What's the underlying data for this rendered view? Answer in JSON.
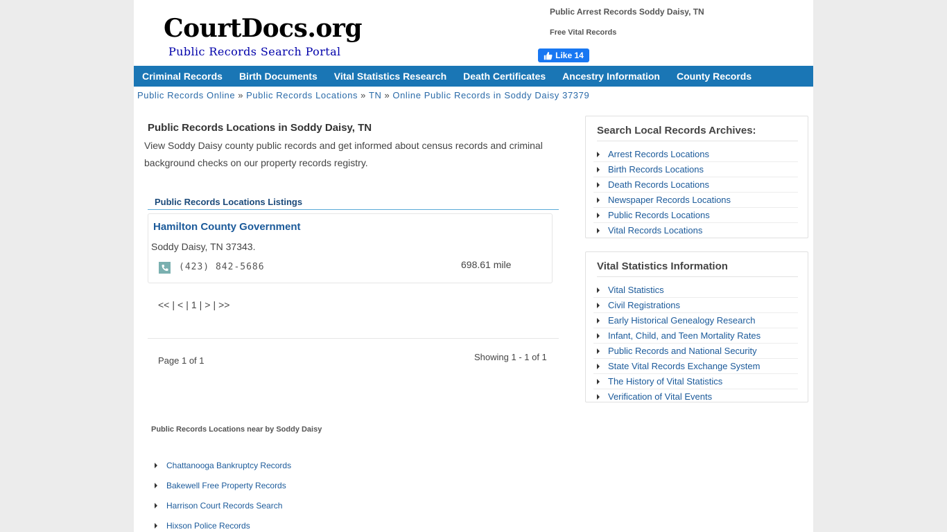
{
  "header": {
    "logo_title": "CourtDocs.org",
    "logo_subtitle": "Public Records Search Portal",
    "top_link_1": "Public Arrest Records Soddy Daisy, TN",
    "top_link_2": "Free Vital Records",
    "fb_like_label": "Like 14",
    "fb_color": "#1877f2"
  },
  "nav": {
    "color": "#1a76b5",
    "items": [
      "Criminal Records",
      "Birth Documents",
      "Vital Statistics Research",
      "Death Certificates",
      "Ancestry Information",
      "County Records"
    ]
  },
  "breadcrumb": {
    "items": [
      "Public Records Online",
      "Public Records Locations",
      "TN",
      "Online Public Records in Soddy Daisy 37379"
    ],
    "separator": "»"
  },
  "main": {
    "title": "Public Records Locations in Soddy Daisy, TN",
    "intro": "View Soddy Daisy county public records and get informed about census records and criminal background checks on our property records registry.",
    "listing_header": "Public Records Locations Listings",
    "listing": {
      "name": "Hamilton County Government",
      "address": "Soddy Daisy, TN 37343.",
      "phone": "(423) 842-5686",
      "distance": "698.61 mile",
      "phone_icon": "phone-icon"
    },
    "pager": {
      "first": "<<",
      "prev": "<",
      "current": "1",
      "next": ">",
      "last": ">>",
      "sep": "|"
    },
    "page_of": "Page 1 of 1",
    "showing": "Showing 1 - 1 of 1",
    "nearby_title": "Public Records Locations near by Soddy Daisy",
    "nearby": [
      "Chattanooga Bankruptcy Records",
      "Bakewell Free Property Records",
      "Harrison Court Records Search",
      "Hixson Police Records"
    ]
  },
  "sidebar": {
    "search_title": "Search Local Records Archives:",
    "search_items": [
      "Arrest Records Locations",
      "Birth Records Locations",
      "Death Records Locations",
      "Newspaper Records Locations",
      "Public Records Locations",
      "Vital Records Locations"
    ],
    "vital_title": "Vital Statistics Information",
    "vital_items": [
      "Vital Statistics",
      "Civil Registrations",
      "Early Historical Genealogy Research",
      "Infant, Child, and Teen Mortality Rates",
      "Public Records and National Security",
      "State Vital Records Exchange System",
      "The History of Vital Statistics",
      "Verification of Vital Events"
    ]
  }
}
